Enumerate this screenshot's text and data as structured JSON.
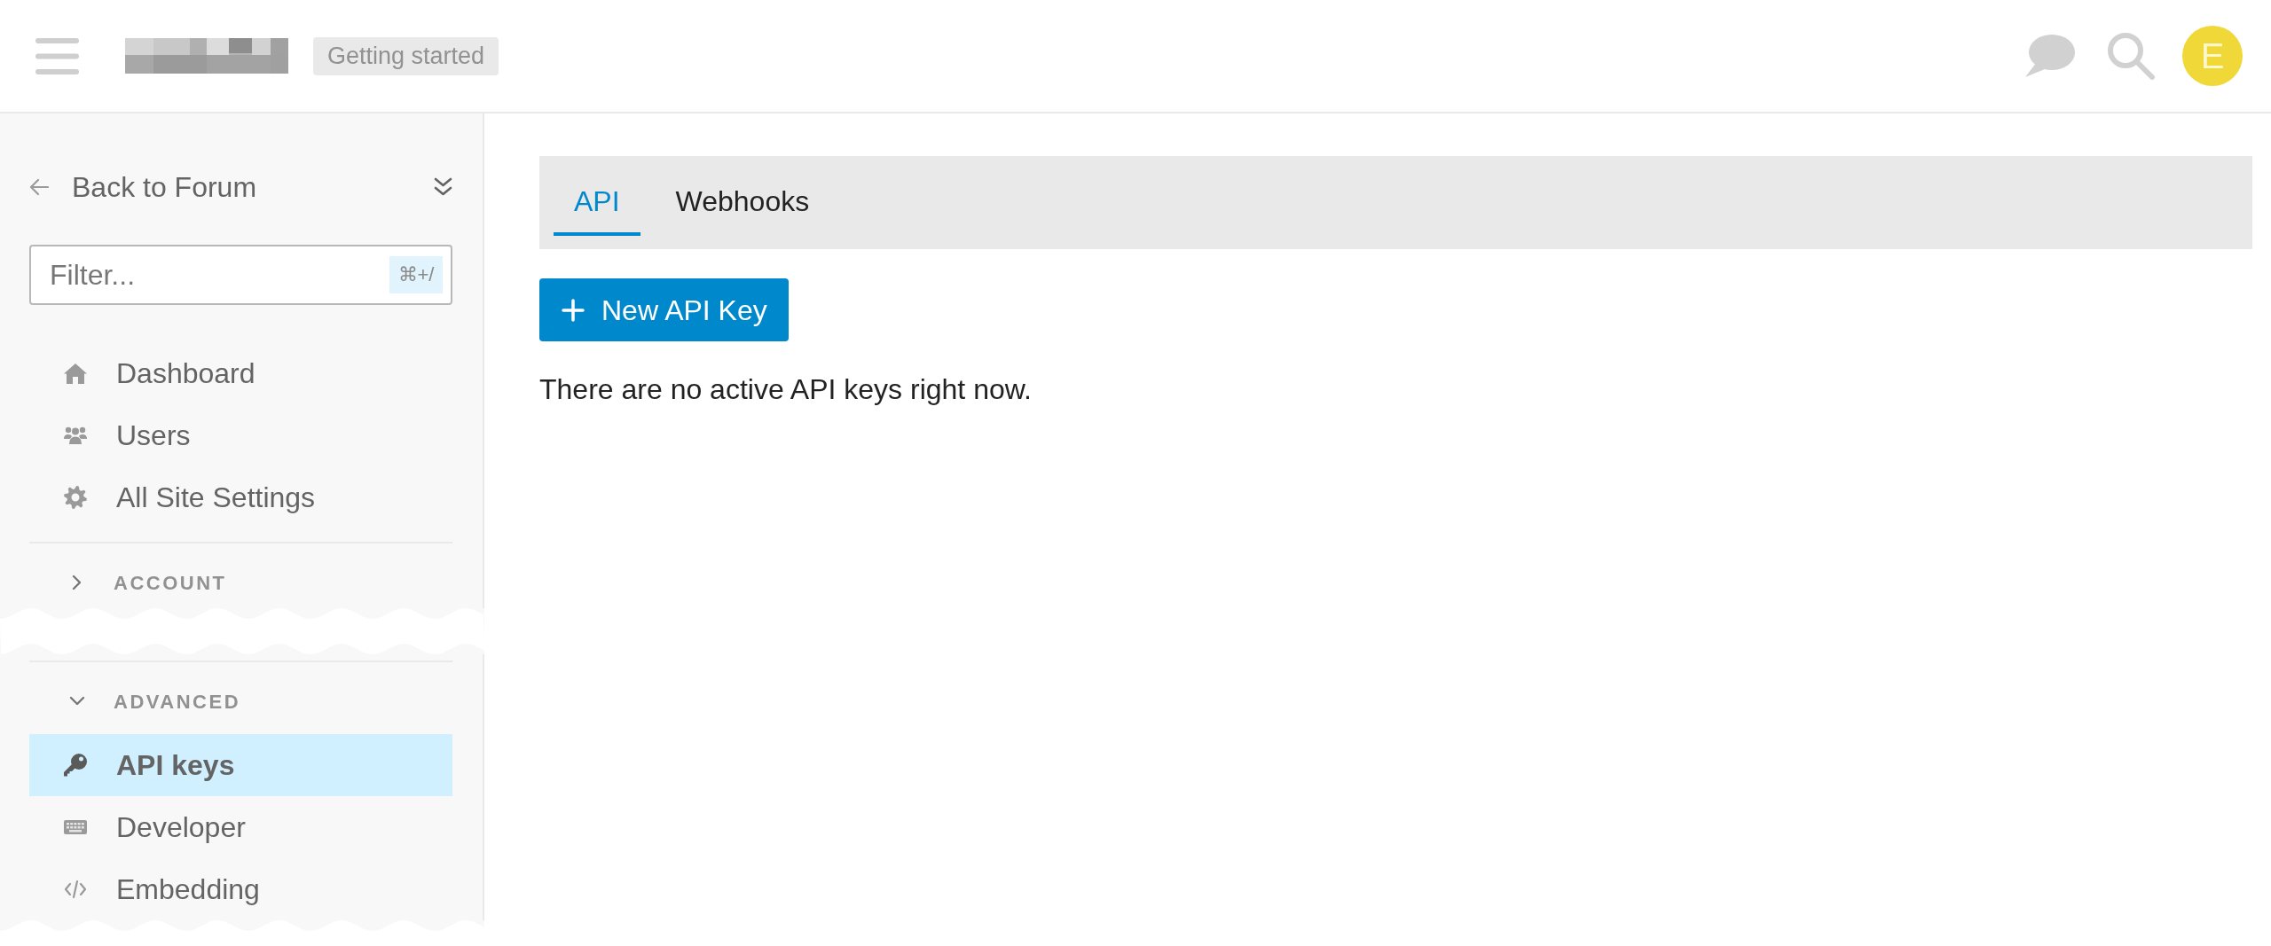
{
  "header": {
    "badge": "Getting started",
    "avatar_initial": "E"
  },
  "sidebar": {
    "back_link": "Back to Forum",
    "filter": {
      "placeholder": "Filter...",
      "shortcut": "⌘+/"
    },
    "items": [
      {
        "label": "Dashboard",
        "selected": false
      },
      {
        "label": "Users",
        "selected": false
      },
      {
        "label": "All Site Settings",
        "selected": false
      }
    ],
    "sections": [
      {
        "title": "ACCOUNT",
        "expanded": false
      },
      {
        "title": "ADVANCED",
        "expanded": true,
        "items": [
          {
            "label": "API keys",
            "selected": true
          },
          {
            "label": "Developer",
            "selected": false
          },
          {
            "label": "Embedding",
            "selected": false
          }
        ]
      }
    ]
  },
  "tabs": [
    {
      "label": "API",
      "selected": true
    },
    {
      "label": "Webhooks",
      "selected": false
    }
  ],
  "new_key_button": "New API Key",
  "message": "There are no active API keys right now."
}
